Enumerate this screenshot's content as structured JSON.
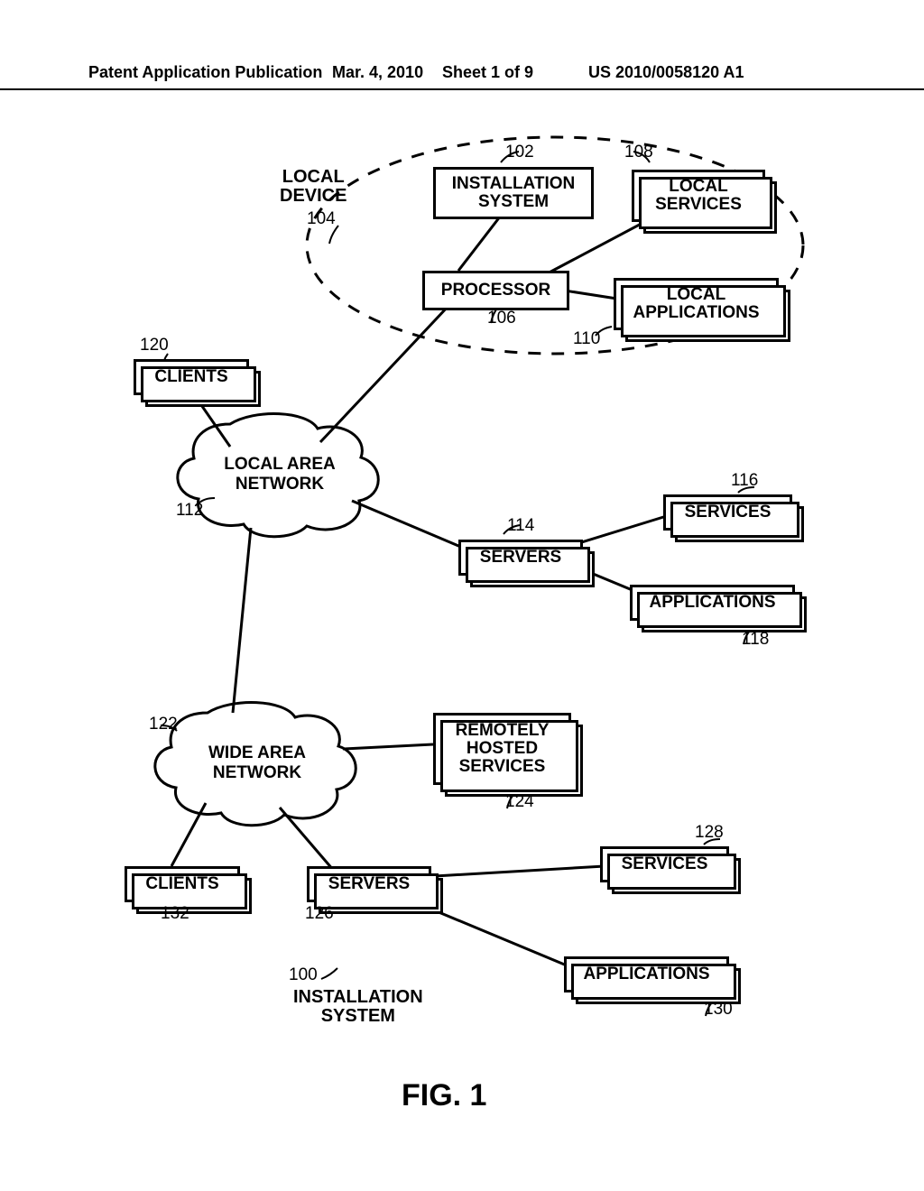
{
  "header": {
    "left": "Patent Application Publication",
    "date": "Mar. 4, 2010",
    "sheet": "Sheet 1 of 9",
    "pubno": "US 2010/0058120 A1"
  },
  "labels": {
    "local_device": "LOCAL\nDEVICE",
    "installation_system_title": "INSTALLATION\nSYSTEM",
    "remotely_hosted": "REMOTELY\nHOSTED\nSERVICES",
    "lan": "LOCAL AREA\nNETWORK",
    "wan": "WIDE AREA\nNETWORK",
    "fig": "FIG. 1"
  },
  "boxes": {
    "installation_system": "INSTALLATION\nSYSTEM",
    "local_services": "LOCAL\nSERVICES",
    "processor": "PROCESSOR",
    "local_applications": "LOCAL\nAPPLICATIONS",
    "clients_top": "CLIENTS",
    "servers_mid": "SERVERS",
    "services_mid": "SERVICES",
    "applications_mid": "APPLICATIONS",
    "clients_bot": "CLIENTS",
    "servers_bot": "SERVERS",
    "services_bot": "SERVICES",
    "applications_bot": "APPLICATIONS"
  },
  "refs": {
    "r100": "100",
    "r102": "102",
    "r104": "104",
    "r106": "106",
    "r108": "108",
    "r110": "110",
    "r112": "112",
    "r114": "114",
    "r116": "116",
    "r118": "118",
    "r120": "120",
    "r122": "122",
    "r124": "124",
    "r126": "126",
    "r128": "128",
    "r130": "130",
    "r132": "132"
  }
}
